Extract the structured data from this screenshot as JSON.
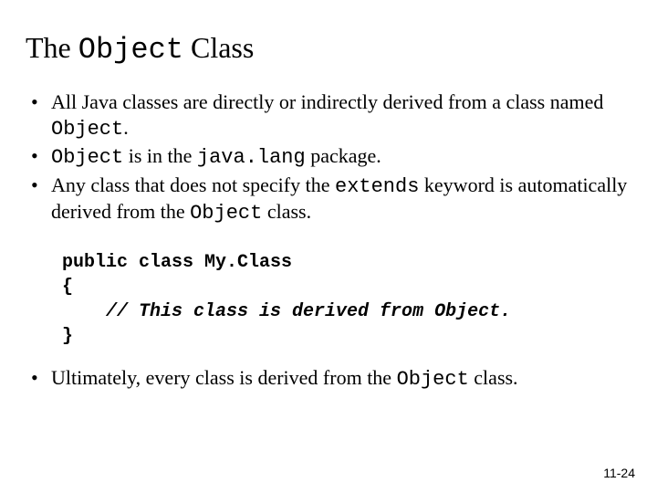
{
  "title": {
    "pre": "The ",
    "code": "Object",
    "post": " Class"
  },
  "bullets_top": [
    {
      "segments": [
        {
          "t": "All Java classes are directly or indirectly derived from a class named "
        },
        {
          "t": "Object",
          "code": true
        },
        {
          "t": "."
        }
      ]
    },
    {
      "segments": [
        {
          "t": "Object",
          "code": true
        },
        {
          "t": " is in the "
        },
        {
          "t": "java.lang",
          "code": true
        },
        {
          "t": " package."
        }
      ]
    },
    {
      "segments": [
        {
          "t": "Any class that does not specify the "
        },
        {
          "t": "extends",
          "code": true
        },
        {
          "t": " keyword is automatically derived from the "
        },
        {
          "t": "Object",
          "code": true
        },
        {
          "t": " class."
        }
      ]
    }
  ],
  "code_block": {
    "line1": "public class My.Class",
    "line2": "{",
    "line3": "    // This class is derived from Object.",
    "line4": "}"
  },
  "bullets_bottom": [
    {
      "segments": [
        {
          "t": "Ultimately, every class is derived from the "
        },
        {
          "t": "Object",
          "code": true
        },
        {
          "t": " class."
        }
      ]
    }
  ],
  "footer": "11-24"
}
